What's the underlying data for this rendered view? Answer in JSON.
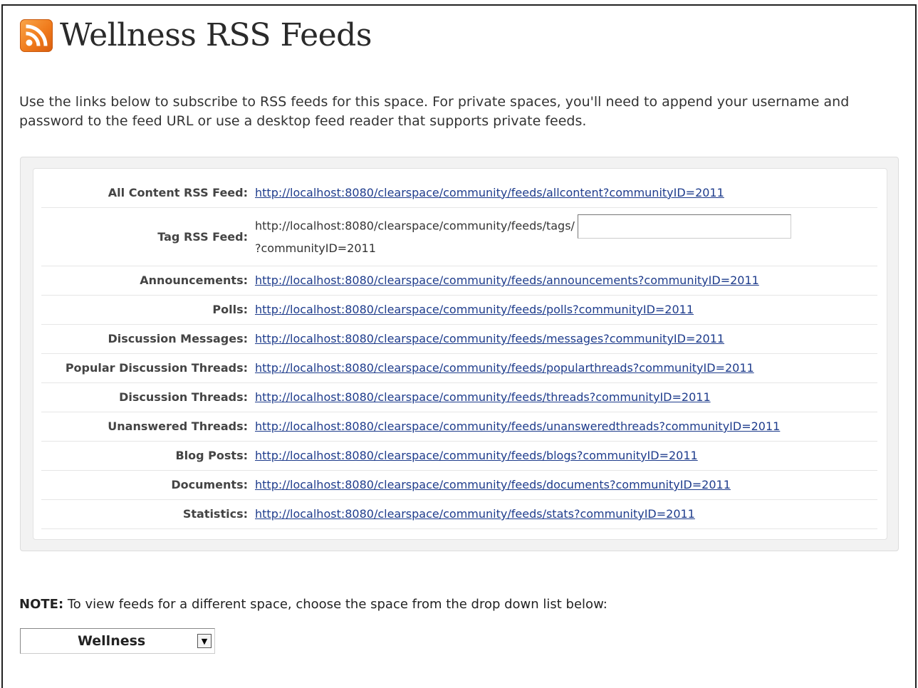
{
  "page": {
    "title": "Wellness RSS Feeds",
    "intro": "Use the links below to subscribe to RSS feeds for this space. For private spaces, you'll need to append your username and password to the feed URL or use a desktop feed reader that supports private feeds."
  },
  "feeds": [
    {
      "label": "All Content RSS Feed:",
      "url": "http://localhost:8080/clearspace/community/feeds/allcontent?communityID=2011"
    },
    {
      "label": "Announcements:",
      "url": "http://localhost:8080/clearspace/community/feeds/announcements?communityID=2011"
    },
    {
      "label": "Polls:",
      "url": "http://localhost:8080/clearspace/community/feeds/polls?communityID=2011"
    },
    {
      "label": "Discussion Messages:",
      "url": "http://localhost:8080/clearspace/community/feeds/messages?communityID=2011"
    },
    {
      "label": "Popular Discussion Threads:",
      "url": "http://localhost:8080/clearspace/community/feeds/popularthreads?communityID=2011"
    },
    {
      "label": "Discussion Threads:",
      "url": "http://localhost:8080/clearspace/community/feeds/threads?communityID=2011"
    },
    {
      "label": "Unanswered Threads:",
      "url": "http://localhost:8080/clearspace/community/feeds/unansweredthreads?communityID=2011"
    },
    {
      "label": "Blog Posts:",
      "url": "http://localhost:8080/clearspace/community/feeds/blogs?communityID=2011"
    },
    {
      "label": "Documents:",
      "url": "http://localhost:8080/clearspace/community/feeds/documents?communityID=2011"
    },
    {
      "label": "Statistics:",
      "url": "http://localhost:8080/clearspace/community/feeds/stats?communityID=2011"
    }
  ],
  "tag_feed": {
    "label": "Tag RSS Feed:",
    "url_prefix": "http://localhost:8080/clearspace/community/feeds/tags/",
    "url_suffix": "?communityID=2011",
    "input_value": ""
  },
  "note": {
    "bold": "NOTE:",
    "text": " To view feeds for a different space, choose the space from the drop down list below:"
  },
  "space_select": {
    "selected": "Wellness"
  },
  "colors": {
    "rss_icon": "#f07b1c",
    "link": "#1e3c8c"
  }
}
